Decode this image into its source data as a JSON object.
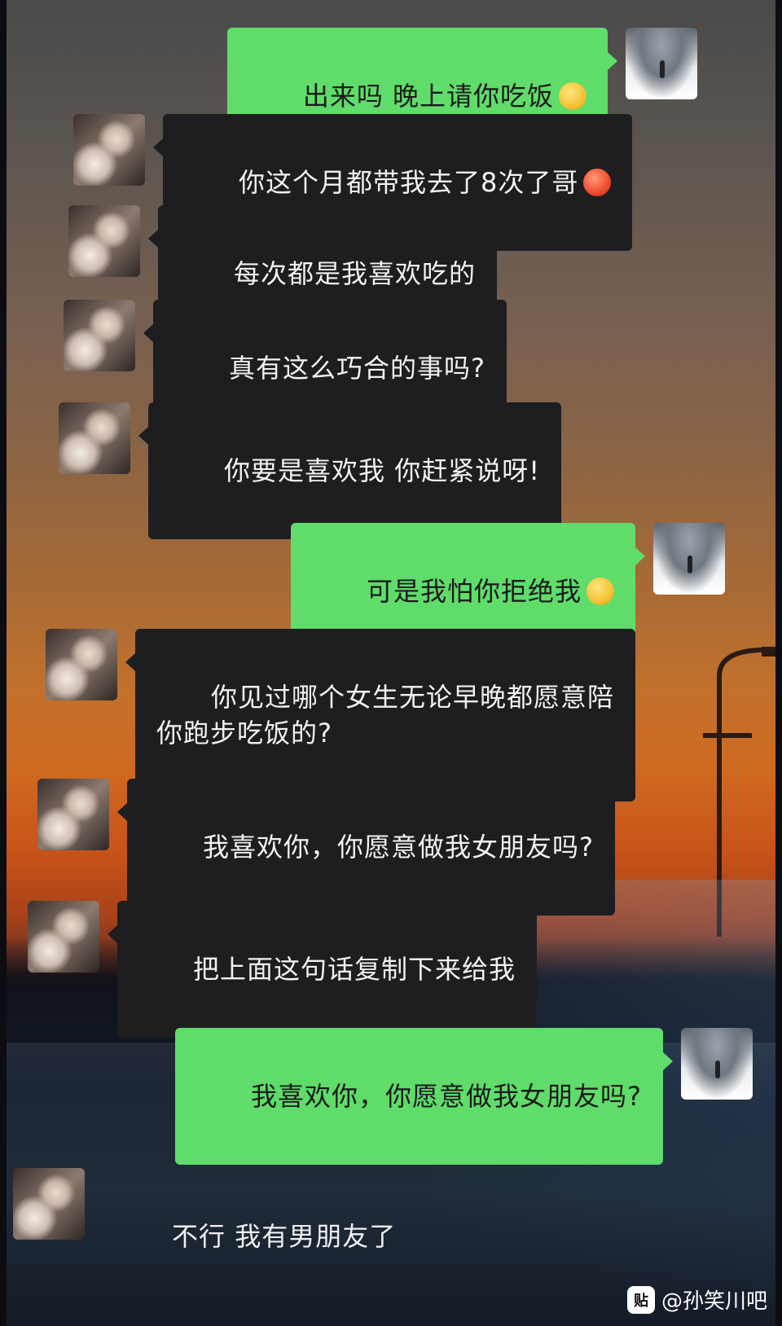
{
  "colors": {
    "sent_bubble": "#5fdc6a",
    "received_bubble": "#1e1e20"
  },
  "messages": [
    {
      "side": "right",
      "text": "出来吗 晚上请你吃饭",
      "emoji": "smile-emoji-icon"
    },
    {
      "side": "left",
      "text": "你这个月都带我去了8次了哥",
      "emoji": "blush-emoji-icon"
    },
    {
      "side": "left",
      "text": "每次都是我喜欢吃的"
    },
    {
      "side": "left",
      "text": "真有这么巧合的事吗?"
    },
    {
      "side": "left",
      "text": "你要是喜欢我 你赶紧说呀!"
    },
    {
      "side": "right",
      "text": "可是我怕你拒绝我",
      "emoji": "shy-emoji-icon"
    },
    {
      "side": "left",
      "text": "你见过哪个女生无论早晚都愿意陪\n你跑步吃饭的?"
    },
    {
      "side": "left",
      "text": "我喜欢你，你愿意做我女朋友吗?"
    },
    {
      "side": "left",
      "text": "把上面这句话复制下来给我"
    },
    {
      "side": "right",
      "text": "我喜欢你，你愿意做我女朋友吗?"
    },
    {
      "side": "left",
      "text": "不行 我有男朋友了"
    }
  ],
  "watermark": {
    "icon_label": "贴",
    "text": "@孙笑川吧"
  }
}
